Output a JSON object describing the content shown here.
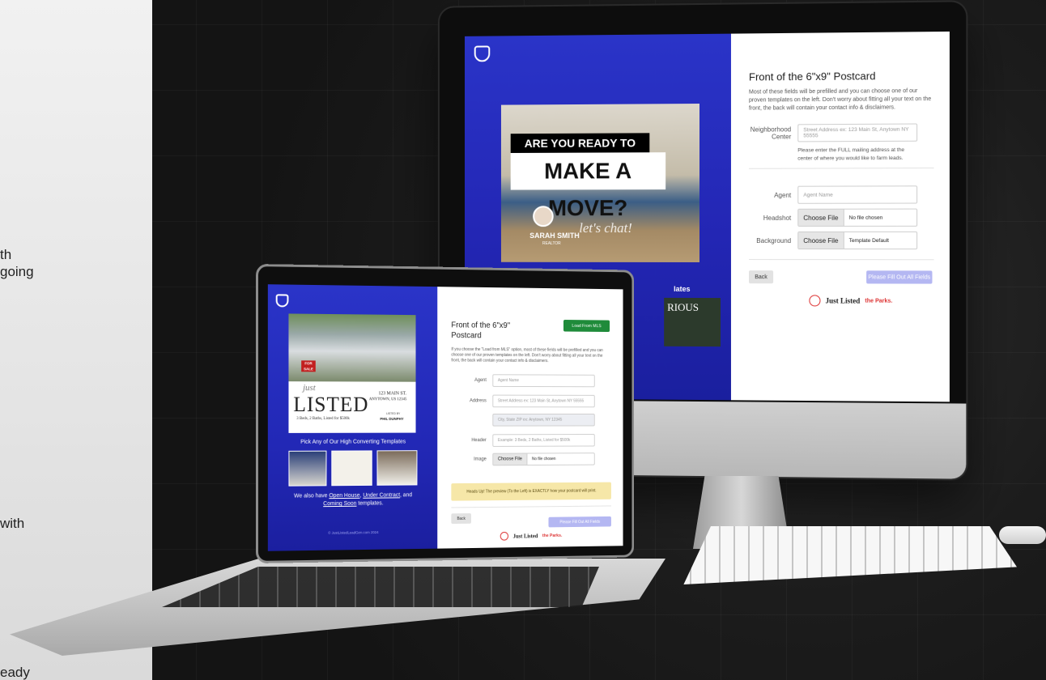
{
  "side_text": {
    "line1": "th",
    "line2": "going",
    "line3": "with",
    "line4": "eady"
  },
  "monitor": {
    "form_title": "Front of the 6\"x9\" Postcard",
    "form_desc": "Most of these fields will be prefilled and you can choose one of our proven templates on the left. Don't worry about fitting all your text on the front, the back will contain your contact info & disclaimers.",
    "neighborhood_label": "Neighborhood Center",
    "neighborhood_placeholder": "Street Address ex: 123 Main St, Anytown NY 55555",
    "neighborhood_help": "Please enter the FULL mailing address at the center of where you would like to farm leads.",
    "agent_label": "Agent",
    "agent_placeholder": "Agent Name",
    "headshot_label": "Headshot",
    "background_label": "Background",
    "choose_file": "Choose File",
    "no_file": "No file chosen",
    "template_default": "Template Default",
    "back_button": "Back",
    "fill_button": "Please Fill Out All Fields",
    "preview": {
      "ready_text": "ARE YOU READY TO",
      "move_text": "MAKE A MOVE?",
      "agent_name": "SARAH SMITH",
      "agent_sub": "REALTOR",
      "script_text": "let's chat!",
      "templates_fragment": "lates",
      "rious_fragment": "RIOUS"
    },
    "brand_text": "Just Listed",
    "brand_sub": "the Parks."
  },
  "laptop": {
    "form_title": "Front of the 6\"x9\" Postcard",
    "load_button": "Load From MLS",
    "form_desc": "If you choose the \"Load from MLS\" option, most of these fields will be prefilled and you can choose one of our proven templates on the left. Don't worry about fitting all your text on the front, the back will contain your contact info & disclaimers.",
    "agent_label": "Agent",
    "agent_placeholder": "Agent Name",
    "address_label": "Address",
    "address_placeholder": "Street Address ex: 123 Main St, Anytown NY 55555",
    "city_placeholder": "City, State ZIP ex: Anytown, NY 12345",
    "header_label": "Header",
    "header_placeholder": "Example: 3 Beds, 2 Baths, Listed for $500k",
    "image_label": "Image",
    "choose_file": "Choose File",
    "no_file": "No file chosen",
    "heads_up": "Heads Up! The preview (To the Left) is EXACTLY how your postcard will print.",
    "back_button": "Back",
    "fill_button": "Please Fill Out All Fields",
    "preview": {
      "for_sale": "FOR SALE",
      "just_text": "just",
      "listed_text": "LISTED",
      "address_line1": "123 MAIN ST.",
      "address_line2": "ANYTOWN, US 12345",
      "details": "3 Beds, 2 Baths, Listed for $500k",
      "listed_by": "LISTED BY",
      "listed_by_name": "PHIL DUNPHY",
      "pick_templates": "Pick Any of Our High Converting Templates",
      "also_have_prefix": "We also have ",
      "open_house": "Open House",
      "comma": ", ",
      "under_contract": "Under Contract",
      "and": ", and",
      "coming_soon": "Coming Soon",
      "templates_suffix": " templates.",
      "footer": "© JustListedLeadGen.com 2024"
    },
    "brand_text": "Just Listed",
    "brand_sub": "the Parks."
  },
  "colors": {
    "brand_blue": "#2a34c8",
    "mls_green": "#1f8b3a",
    "heads_up_bg": "#f6e7a8",
    "disabled_button": "#b4b7f2"
  }
}
